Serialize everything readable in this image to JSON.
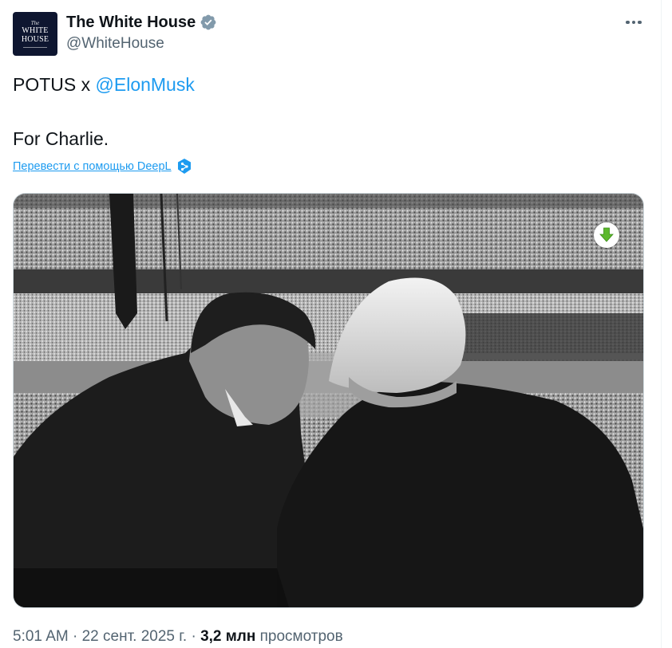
{
  "author": {
    "display_name": "The White House",
    "handle": "@WhiteHouse",
    "verified": true,
    "avatar_text_top": "The",
    "avatar_text_line1": "WHITE",
    "avatar_text_line2": "HOUSE"
  },
  "tweet": {
    "line1_prefix": "POTUS x ",
    "mention": "@ElonMusk",
    "line2": "For Charlie.",
    "translate_link": "Перевести с помощью DeepL"
  },
  "meta": {
    "time": "5:01 AM",
    "separator1": " · ",
    "date": "22 сент. 2025 г.",
    "separator2": " · ",
    "views_count": "3,2 млн",
    "views_label": " просмотров"
  },
  "icons": {
    "verified": "verified-badge-icon",
    "more": "more-options-icon",
    "deepl": "deepl-icon",
    "download": "download-arrow-icon"
  },
  "colors": {
    "text": "#0f1419",
    "secondary": "#536471",
    "link": "#1d9bf0",
    "download_green": "#5cb82c"
  }
}
